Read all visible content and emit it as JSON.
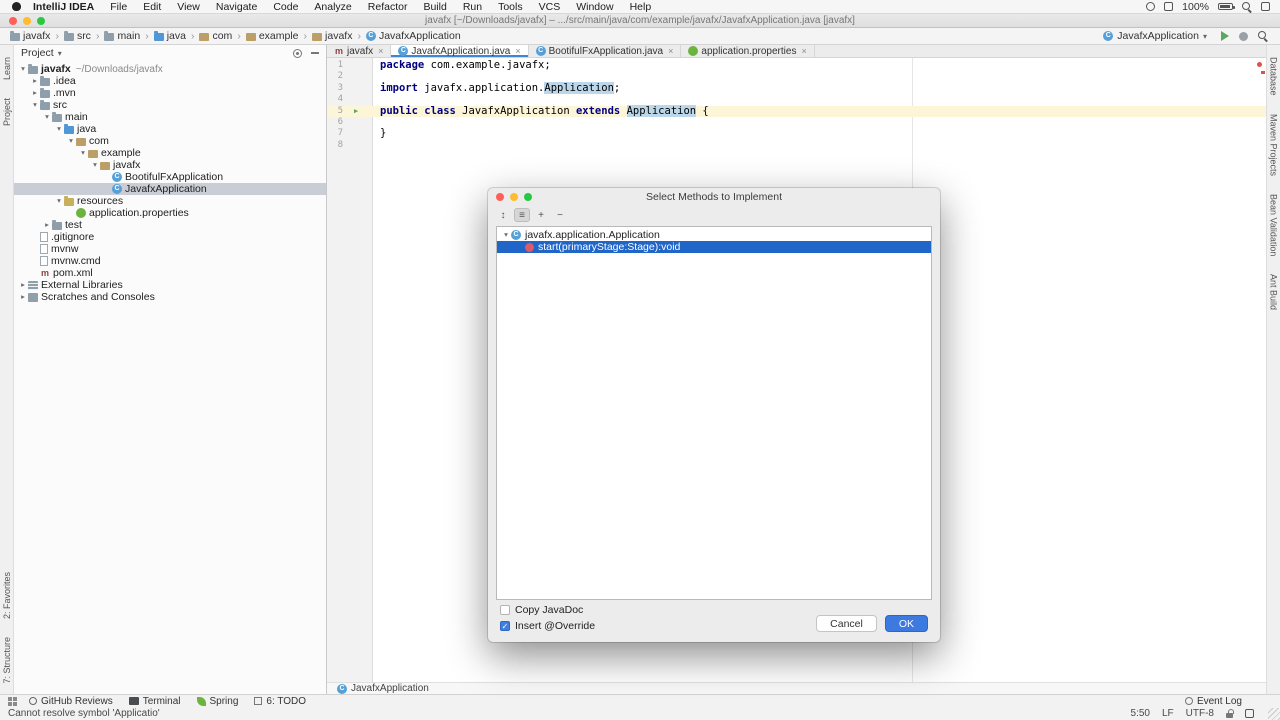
{
  "glyphs": {
    "chevron_open": "▾",
    "chevron_closed": "▸",
    "crumb_separator": "›",
    "tab_close": "×",
    "checkbox_check": "✓",
    "run_marker": "▶",
    "class_letter": "C",
    "maven_letter": "m"
  },
  "colors": {
    "accent": "#3e86d6",
    "selection_blue": "#2065c8",
    "inactive_selection": "#c9ced6",
    "error_red": "#e0514c",
    "spring_green": "#6db33f",
    "keyword_navy": "#000080"
  },
  "menubar": {
    "items": [
      "IntelliJ IDEA",
      "File",
      "Edit",
      "View",
      "Navigate",
      "Code",
      "Analyze",
      "Refactor",
      "Build",
      "Run",
      "Tools",
      "VCS",
      "Window",
      "Help"
    ],
    "battery": "100%"
  },
  "titlebar": {
    "title": "javafx [~/Downloads/javafx] – .../src/main/java/com/example/javafx/JavafxApplication.java [javafx]"
  },
  "navbar": {
    "crumbs": [
      {
        "label": "javafx",
        "icon": "folder"
      },
      {
        "label": "src",
        "icon": "folder"
      },
      {
        "label": "main",
        "icon": "folder"
      },
      {
        "label": "java",
        "icon": "folder-src"
      },
      {
        "label": "com",
        "icon": "package"
      },
      {
        "label": "example",
        "icon": "package"
      },
      {
        "label": "javafx",
        "icon": "package"
      },
      {
        "label": "JavafxApplication",
        "icon": "class"
      }
    ],
    "run_config": "JavafxApplication"
  },
  "left_stripe": {
    "top": [
      "Learn",
      "Project"
    ],
    "bottom": [
      "2: Favorites",
      "7: Structure"
    ]
  },
  "right_stripe": [
    "Database",
    "Maven Projects",
    "Bean Validation",
    "Ant Build"
  ],
  "project": {
    "title": "Project",
    "tree": [
      {
        "label": "javafx",
        "hint": "~/Downloads/javafx",
        "level": 0,
        "icon": "folder",
        "chev": "open",
        "bold": true
      },
      {
        "label": ".idea",
        "level": 1,
        "icon": "folder",
        "chev": "closed"
      },
      {
        "label": ".mvn",
        "level": 1,
        "icon": "folder",
        "chev": "closed"
      },
      {
        "label": "src",
        "level": 1,
        "icon": "folder",
        "chev": "open"
      },
      {
        "label": "main",
        "level": 2,
        "icon": "folder",
        "chev": "open"
      },
      {
        "label": "java",
        "level": 3,
        "icon": "folder-src",
        "chev": "open"
      },
      {
        "label": "com",
        "level": 4,
        "icon": "package",
        "chev": "open"
      },
      {
        "label": "example",
        "level": 5,
        "icon": "package",
        "chev": "open"
      },
      {
        "label": "javafx",
        "level": 6,
        "icon": "package",
        "chev": "open"
      },
      {
        "label": "BootifulFxApplication",
        "level": 7,
        "icon": "class"
      },
      {
        "label": "JavafxApplication",
        "level": 7,
        "icon": "class",
        "selected": true
      },
      {
        "label": "resources",
        "level": 3,
        "icon": "folder-res",
        "chev": "open"
      },
      {
        "label": "application.properties",
        "level": 4,
        "icon": "props"
      },
      {
        "label": "test",
        "level": 2,
        "icon": "folder",
        "chev": "closed"
      },
      {
        "label": ".gitignore",
        "level": 1,
        "icon": "file"
      },
      {
        "label": "mvnw",
        "level": 1,
        "icon": "file"
      },
      {
        "label": "mvnw.cmd",
        "level": 1,
        "icon": "file"
      },
      {
        "label": "pom.xml",
        "level": 1,
        "icon": "maven"
      },
      {
        "label": "External Libraries",
        "level": 0,
        "icon": "lib",
        "chev": "closed"
      },
      {
        "label": "Scratches and Consoles",
        "level": 0,
        "icon": "scratch",
        "chev": "closed"
      }
    ]
  },
  "editor": {
    "tabs": [
      {
        "label": "javafx",
        "icon": "maven"
      },
      {
        "label": "JavafxApplication.java",
        "icon": "class",
        "selected": true
      },
      {
        "label": "BootifulFxApplication.java",
        "icon": "class"
      },
      {
        "label": "application.properties",
        "icon": "props"
      }
    ],
    "lines": [
      {
        "n": 1,
        "segs": [
          {
            "t": "package",
            "c": "kw"
          },
          {
            "t": " com.example.javafx;"
          }
        ]
      },
      {
        "n": 2,
        "segs": []
      },
      {
        "n": 3,
        "segs": [
          {
            "t": "import",
            "c": "kw"
          },
          {
            "t": " javafx.application."
          },
          {
            "t": "Application",
            "c": "hl"
          },
          {
            "t": ";"
          }
        ]
      },
      {
        "n": 4,
        "segs": []
      },
      {
        "n": 5,
        "current": true,
        "run": true,
        "segs": [
          {
            "t": "public class",
            "c": "kw"
          },
          {
            "t": " JavafxApplication "
          },
          {
            "t": "extends",
            "c": "kw"
          },
          {
            "t": " "
          },
          {
            "t": "Application",
            "c": "hl"
          },
          {
            "t": " {"
          }
        ]
      },
      {
        "n": 6,
        "segs": []
      },
      {
        "n": 7,
        "segs": [
          {
            "t": "}"
          }
        ]
      },
      {
        "n": 8,
        "segs": []
      }
    ],
    "breadcrumb": "JavafxApplication"
  },
  "dialog": {
    "title": "Select Methods to Implement",
    "toolbar": [
      {
        "name": "sort-alphabetically",
        "glyph": "↕"
      },
      {
        "name": "show-classes",
        "glyph": "≡",
        "pressed": true
      },
      {
        "name": "expand-all",
        "glyph": "+"
      },
      {
        "name": "collapse-all",
        "glyph": "−"
      }
    ],
    "tree": [
      {
        "label": "javafx.application.Application",
        "icon": "class",
        "chev": "open",
        "level": 0
      },
      {
        "label": "start(primaryStage:Stage):void",
        "icon": "method",
        "level": 1,
        "selected": true
      }
    ],
    "checkboxes": [
      {
        "label": "Copy JavaDoc",
        "checked": false
      },
      {
        "label": "Insert @Override",
        "checked": true
      }
    ],
    "buttons": {
      "cancel": "Cancel",
      "ok": "OK"
    }
  },
  "bottom_bar": {
    "left": [
      {
        "label": "GitHub Reviews",
        "icon": "gh"
      },
      {
        "label": "Terminal",
        "icon": "terminal"
      },
      {
        "label": "Spring",
        "icon": "leaf"
      },
      {
        "label": "6: TODO",
        "icon": "todo"
      }
    ],
    "right": {
      "label": "Event Log",
      "icon": "eventlog"
    }
  },
  "statusbar": {
    "message": "Cannot resolve symbol 'Applicatio'",
    "position": "5:50",
    "line_separator": "LF",
    "encoding": "UTF-8"
  }
}
